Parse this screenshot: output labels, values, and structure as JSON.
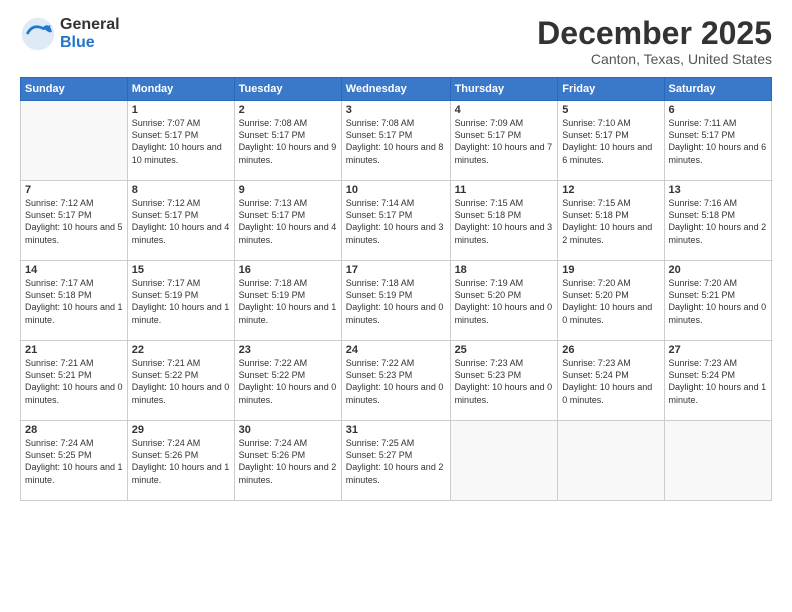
{
  "logo": {
    "general": "General",
    "blue": "Blue"
  },
  "header": {
    "month": "December 2025",
    "location": "Canton, Texas, United States"
  },
  "weekdays": [
    "Sunday",
    "Monday",
    "Tuesday",
    "Wednesday",
    "Thursday",
    "Friday",
    "Saturday"
  ],
  "weeks": [
    [
      {
        "num": "",
        "sunrise": "",
        "sunset": "",
        "daylight": "",
        "empty": true
      },
      {
        "num": "1",
        "sunrise": "Sunrise: 7:07 AM",
        "sunset": "Sunset: 5:17 PM",
        "daylight": "Daylight: 10 hours and 10 minutes."
      },
      {
        "num": "2",
        "sunrise": "Sunrise: 7:08 AM",
        "sunset": "Sunset: 5:17 PM",
        "daylight": "Daylight: 10 hours and 9 minutes."
      },
      {
        "num": "3",
        "sunrise": "Sunrise: 7:08 AM",
        "sunset": "Sunset: 5:17 PM",
        "daylight": "Daylight: 10 hours and 8 minutes."
      },
      {
        "num": "4",
        "sunrise": "Sunrise: 7:09 AM",
        "sunset": "Sunset: 5:17 PM",
        "daylight": "Daylight: 10 hours and 7 minutes."
      },
      {
        "num": "5",
        "sunrise": "Sunrise: 7:10 AM",
        "sunset": "Sunset: 5:17 PM",
        "daylight": "Daylight: 10 hours and 6 minutes."
      },
      {
        "num": "6",
        "sunrise": "Sunrise: 7:11 AM",
        "sunset": "Sunset: 5:17 PM",
        "daylight": "Daylight: 10 hours and 6 minutes."
      }
    ],
    [
      {
        "num": "7",
        "sunrise": "Sunrise: 7:12 AM",
        "sunset": "Sunset: 5:17 PM",
        "daylight": "Daylight: 10 hours and 5 minutes."
      },
      {
        "num": "8",
        "sunrise": "Sunrise: 7:12 AM",
        "sunset": "Sunset: 5:17 PM",
        "daylight": "Daylight: 10 hours and 4 minutes."
      },
      {
        "num": "9",
        "sunrise": "Sunrise: 7:13 AM",
        "sunset": "Sunset: 5:17 PM",
        "daylight": "Daylight: 10 hours and 4 minutes."
      },
      {
        "num": "10",
        "sunrise": "Sunrise: 7:14 AM",
        "sunset": "Sunset: 5:17 PM",
        "daylight": "Daylight: 10 hours and 3 minutes."
      },
      {
        "num": "11",
        "sunrise": "Sunrise: 7:15 AM",
        "sunset": "Sunset: 5:18 PM",
        "daylight": "Daylight: 10 hours and 3 minutes."
      },
      {
        "num": "12",
        "sunrise": "Sunrise: 7:15 AM",
        "sunset": "Sunset: 5:18 PM",
        "daylight": "Daylight: 10 hours and 2 minutes."
      },
      {
        "num": "13",
        "sunrise": "Sunrise: 7:16 AM",
        "sunset": "Sunset: 5:18 PM",
        "daylight": "Daylight: 10 hours and 2 minutes."
      }
    ],
    [
      {
        "num": "14",
        "sunrise": "Sunrise: 7:17 AM",
        "sunset": "Sunset: 5:18 PM",
        "daylight": "Daylight: 10 hours and 1 minute."
      },
      {
        "num": "15",
        "sunrise": "Sunrise: 7:17 AM",
        "sunset": "Sunset: 5:19 PM",
        "daylight": "Daylight: 10 hours and 1 minute."
      },
      {
        "num": "16",
        "sunrise": "Sunrise: 7:18 AM",
        "sunset": "Sunset: 5:19 PM",
        "daylight": "Daylight: 10 hours and 1 minute."
      },
      {
        "num": "17",
        "sunrise": "Sunrise: 7:18 AM",
        "sunset": "Sunset: 5:19 PM",
        "daylight": "Daylight: 10 hours and 0 minutes."
      },
      {
        "num": "18",
        "sunrise": "Sunrise: 7:19 AM",
        "sunset": "Sunset: 5:20 PM",
        "daylight": "Daylight: 10 hours and 0 minutes."
      },
      {
        "num": "19",
        "sunrise": "Sunrise: 7:20 AM",
        "sunset": "Sunset: 5:20 PM",
        "daylight": "Daylight: 10 hours and 0 minutes."
      },
      {
        "num": "20",
        "sunrise": "Sunrise: 7:20 AM",
        "sunset": "Sunset: 5:21 PM",
        "daylight": "Daylight: 10 hours and 0 minutes."
      }
    ],
    [
      {
        "num": "21",
        "sunrise": "Sunrise: 7:21 AM",
        "sunset": "Sunset: 5:21 PM",
        "daylight": "Daylight: 10 hours and 0 minutes."
      },
      {
        "num": "22",
        "sunrise": "Sunrise: 7:21 AM",
        "sunset": "Sunset: 5:22 PM",
        "daylight": "Daylight: 10 hours and 0 minutes."
      },
      {
        "num": "23",
        "sunrise": "Sunrise: 7:22 AM",
        "sunset": "Sunset: 5:22 PM",
        "daylight": "Daylight: 10 hours and 0 minutes."
      },
      {
        "num": "24",
        "sunrise": "Sunrise: 7:22 AM",
        "sunset": "Sunset: 5:23 PM",
        "daylight": "Daylight: 10 hours and 0 minutes."
      },
      {
        "num": "25",
        "sunrise": "Sunrise: 7:23 AM",
        "sunset": "Sunset: 5:23 PM",
        "daylight": "Daylight: 10 hours and 0 minutes."
      },
      {
        "num": "26",
        "sunrise": "Sunrise: 7:23 AM",
        "sunset": "Sunset: 5:24 PM",
        "daylight": "Daylight: 10 hours and 0 minutes."
      },
      {
        "num": "27",
        "sunrise": "Sunrise: 7:23 AM",
        "sunset": "Sunset: 5:24 PM",
        "daylight": "Daylight: 10 hours and 1 minute."
      }
    ],
    [
      {
        "num": "28",
        "sunrise": "Sunrise: 7:24 AM",
        "sunset": "Sunset: 5:25 PM",
        "daylight": "Daylight: 10 hours and 1 minute."
      },
      {
        "num": "29",
        "sunrise": "Sunrise: 7:24 AM",
        "sunset": "Sunset: 5:26 PM",
        "daylight": "Daylight: 10 hours and 1 minute."
      },
      {
        "num": "30",
        "sunrise": "Sunrise: 7:24 AM",
        "sunset": "Sunset: 5:26 PM",
        "daylight": "Daylight: 10 hours and 2 minutes."
      },
      {
        "num": "31",
        "sunrise": "Sunrise: 7:25 AM",
        "sunset": "Sunset: 5:27 PM",
        "daylight": "Daylight: 10 hours and 2 minutes."
      },
      {
        "num": "",
        "sunrise": "",
        "sunset": "",
        "daylight": "",
        "empty": true
      },
      {
        "num": "",
        "sunrise": "",
        "sunset": "",
        "daylight": "",
        "empty": true
      },
      {
        "num": "",
        "sunrise": "",
        "sunset": "",
        "daylight": "",
        "empty": true
      }
    ]
  ]
}
